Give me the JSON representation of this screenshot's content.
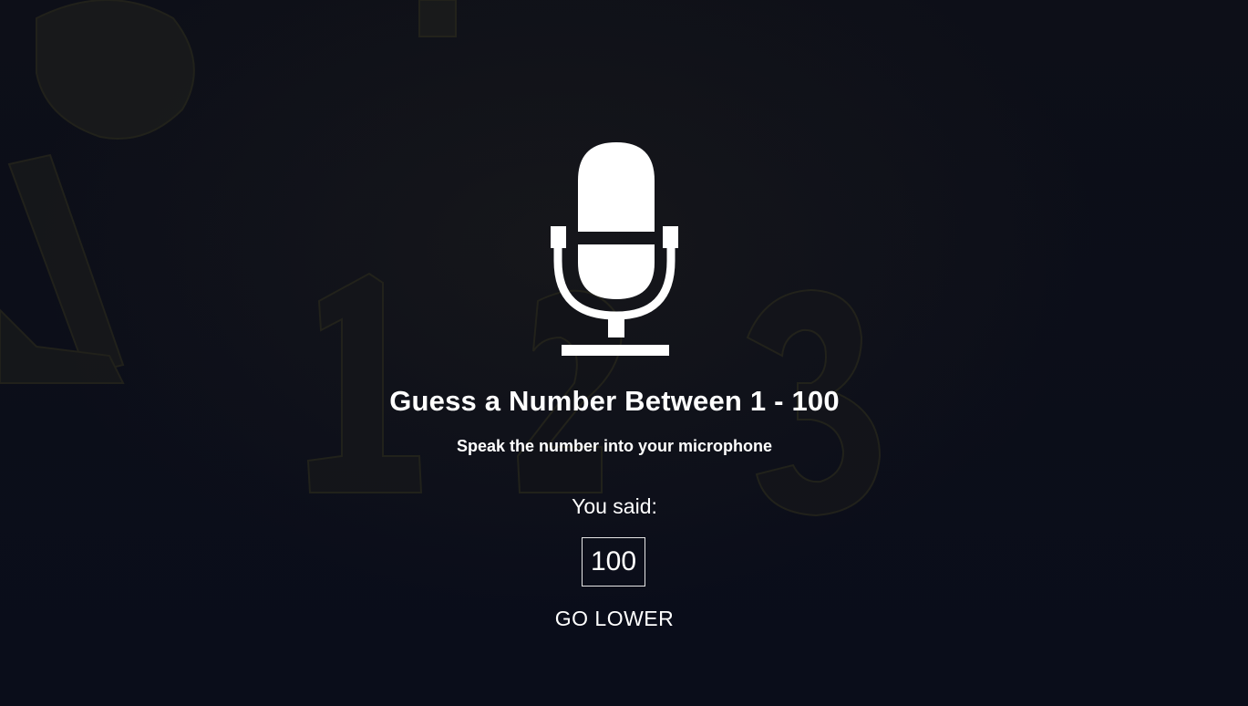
{
  "game": {
    "title": "Guess a Number Between 1 - 100",
    "subtitle": "Speak the number into your microphone",
    "you_said_label": "You said:",
    "last_guess": "100",
    "hint": "GO LOWER"
  },
  "icons": {
    "main": "microphone-icon"
  },
  "colors": {
    "background": "#0b0e19",
    "text": "#ffffff",
    "background_numbers": "#2a2a22"
  }
}
